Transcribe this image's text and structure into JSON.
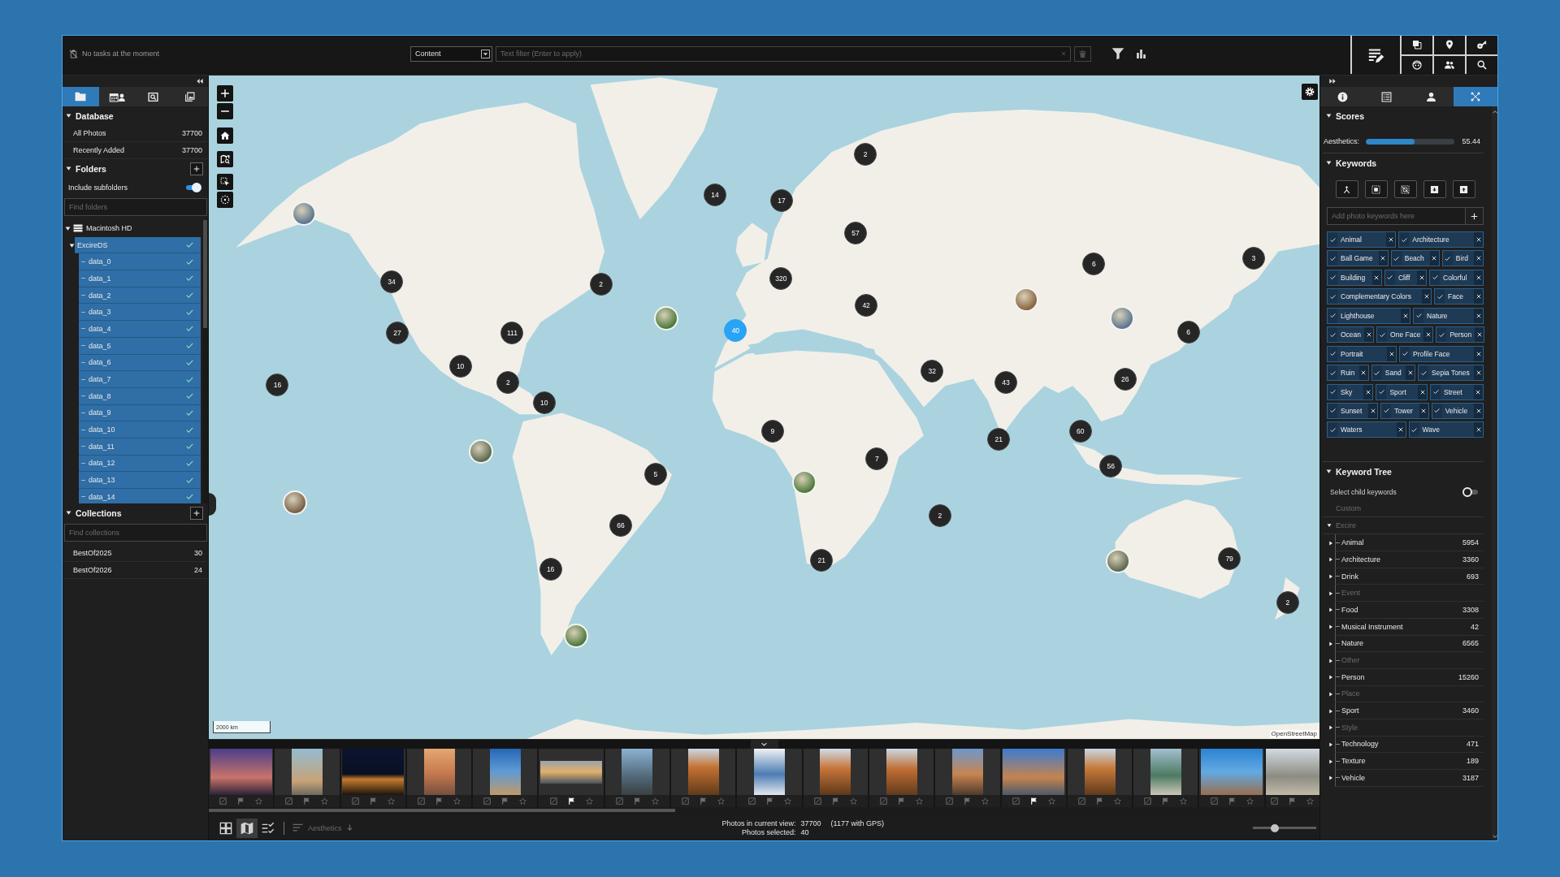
{
  "topbar": {
    "tasks": "No tasks at the moment",
    "content_select": {
      "value": "Content"
    },
    "text_filter": {
      "placeholder": "Text filter (Enter to apply)"
    }
  },
  "left_sidebar": {
    "tabs": [
      {
        "kind": "folders",
        "selected": true
      },
      {
        "kind": "calendar-people",
        "selected": false
      },
      {
        "kind": "image-search",
        "selected": false
      },
      {
        "kind": "gallery",
        "selected": false
      }
    ],
    "database": {
      "title": "Database",
      "expanded": true,
      "items": [
        {
          "label": "All Photos",
          "count": "37700"
        },
        {
          "label": "Recently Added",
          "count": "37700"
        }
      ]
    },
    "folders": {
      "title": "Folders",
      "expanded": true,
      "include_subfolders": {
        "label": "Include subfolders",
        "on": true
      },
      "search": {
        "placeholder": "Find folders"
      },
      "tree": [
        {
          "label": "Macintosh HD",
          "expanded": true,
          "selected": false,
          "children": [
            {
              "label": "ExcireDS",
              "expanded": true,
              "selected": true,
              "checked": true,
              "children": [
                {
                  "label": "data_0",
                  "selected": true,
                  "checked": true
                },
                {
                  "label": "data_1",
                  "selected": true,
                  "checked": true
                },
                {
                  "label": "data_2",
                  "selected": true,
                  "checked": true
                },
                {
                  "label": "data_3",
                  "selected": true,
                  "checked": true
                },
                {
                  "label": "data_4",
                  "selected": true,
                  "checked": true
                },
                {
                  "label": "data_5",
                  "selected": true,
                  "checked": true
                },
                {
                  "label": "data_6",
                  "selected": true,
                  "checked": true
                },
                {
                  "label": "data_7",
                  "selected": true,
                  "checked": true
                },
                {
                  "label": "data_8",
                  "selected": true,
                  "checked": true
                },
                {
                  "label": "data_9",
                  "selected": true,
                  "checked": true
                },
                {
                  "label": "data_10",
                  "selected": true,
                  "checked": true
                },
                {
                  "label": "data_11",
                  "selected": true,
                  "checked": true
                },
                {
                  "label": "data_12",
                  "selected": true,
                  "checked": true
                },
                {
                  "label": "data_13",
                  "selected": true,
                  "checked": true
                },
                {
                  "label": "data_14",
                  "selected": true,
                  "checked": true
                }
              ]
            }
          ]
        }
      ]
    },
    "collections": {
      "title": "Collections",
      "expanded": true,
      "search": {
        "placeholder": "Find collections"
      },
      "items": [
        {
          "label": "BestOf2025",
          "count": "30"
        },
        {
          "label": "BestOf2026",
          "count": "24"
        }
      ]
    }
  },
  "map": {
    "markers": [
      {
        "kind": "cluster",
        "count": "2",
        "selected": false
      },
      {
        "kind": "cluster",
        "count": "14",
        "selected": false
      },
      {
        "kind": "cluster",
        "count": "17",
        "selected": false
      },
      {
        "kind": "photo",
        "selected": false
      },
      {
        "kind": "cluster",
        "count": "57",
        "selected": false
      },
      {
        "kind": "cluster",
        "count": "6",
        "selected": false
      },
      {
        "kind": "cluster",
        "count": "3",
        "selected": false
      },
      {
        "kind": "cluster",
        "count": "34",
        "selected": false
      },
      {
        "kind": "cluster",
        "count": "2",
        "selected": false
      },
      {
        "kind": "cluster",
        "count": "320",
        "selected": false
      },
      {
        "kind": "cluster",
        "count": "42",
        "selected": false
      },
      {
        "kind": "photo",
        "selected": false
      },
      {
        "kind": "photo",
        "selected": false
      },
      {
        "kind": "photo",
        "selected": false
      },
      {
        "kind": "cluster",
        "count": "27",
        "selected": false
      },
      {
        "kind": "cluster",
        "count": "111",
        "selected": false
      },
      {
        "kind": "cluster",
        "count": "40",
        "selected": true
      },
      {
        "kind": "cluster",
        "count": "6",
        "selected": false
      },
      {
        "kind": "cluster",
        "count": "10",
        "selected": false
      },
      {
        "kind": "cluster",
        "count": "32",
        "selected": false
      },
      {
        "kind": "cluster",
        "count": "16",
        "selected": false
      },
      {
        "kind": "cluster",
        "count": "2",
        "selected": false
      },
      {
        "kind": "cluster",
        "count": "43",
        "selected": false
      },
      {
        "kind": "cluster",
        "count": "26",
        "selected": false
      },
      {
        "kind": "cluster",
        "count": "10",
        "selected": false
      },
      {
        "kind": "cluster",
        "count": "9",
        "selected": false
      },
      {
        "kind": "cluster",
        "count": "21",
        "selected": false
      },
      {
        "kind": "cluster",
        "count": "60",
        "selected": false
      },
      {
        "kind": "photo",
        "selected": false
      },
      {
        "kind": "cluster",
        "count": "7",
        "selected": false
      },
      {
        "kind": "cluster",
        "count": "5",
        "selected": false
      },
      {
        "kind": "cluster",
        "count": "56",
        "selected": false
      },
      {
        "kind": "photo",
        "selected": false
      },
      {
        "kind": "edge-cluster",
        "selected": false
      },
      {
        "kind": "photo",
        "selected": false
      },
      {
        "kind": "cluster",
        "count": "66",
        "selected": false
      },
      {
        "kind": "cluster",
        "count": "2",
        "selected": false
      },
      {
        "kind": "cluster",
        "count": "21",
        "selected": false
      },
      {
        "kind": "photo",
        "selected": false
      },
      {
        "kind": "cluster",
        "count": "79",
        "selected": false
      },
      {
        "kind": "cluster",
        "count": "16",
        "selected": false
      },
      {
        "kind": "cluster",
        "count": "2",
        "selected": false
      },
      {
        "kind": "photo",
        "selected": false
      }
    ],
    "scale": "2000 km",
    "attribution": "OpenStreetMap"
  },
  "filmstrip": {
    "thumbnails": [
      {
        "flagged": false
      },
      {
        "flagged": false
      },
      {
        "flagged": false
      },
      {
        "flagged": false
      },
      {
        "flagged": false
      },
      {
        "flagged": true
      },
      {
        "flagged": false
      },
      {
        "flagged": false
      },
      {
        "flagged": false
      },
      {
        "flagged": false
      },
      {
        "flagged": false
      },
      {
        "flagged": false
      },
      {
        "flagged": true
      },
      {
        "flagged": false
      },
      {
        "flagged": false
      },
      {
        "flagged": false
      },
      {
        "flagged": false
      }
    ]
  },
  "status_bar": {
    "view_modes": [
      {
        "kind": "grid",
        "selected": false
      },
      {
        "kind": "map",
        "selected": true
      },
      {
        "kind": "checklist",
        "selected": false
      }
    ],
    "sort": {
      "label": "Aesthetics",
      "disabled": true
    },
    "lines": [
      {
        "label": "Photos in current view:",
        "value": "37700",
        "note": "(1177 with GPS)"
      },
      {
        "label": "Photos selected:",
        "value": "40"
      }
    ],
    "zoom_slider": {
      "level": 0.33
    }
  },
  "right_panel": {
    "tabs": [
      {
        "kind": "info",
        "selected": false
      },
      {
        "kind": "details",
        "selected": false
      },
      {
        "kind": "person",
        "selected": false
      },
      {
        "kind": "network",
        "selected": true
      }
    ],
    "scores": {
      "title": "Scores",
      "expanded": true,
      "items": [
        {
          "label": "Aesthetics:",
          "level": 0.55,
          "reading": "55.44"
        }
      ]
    },
    "keywords": {
      "title": "Keywords",
      "expanded": true,
      "input": {
        "placeholder": "Add photo keywords here"
      },
      "chips": [
        {
          "label": "Animal",
          "checked": true
        },
        {
          "label": "Architecture",
          "checked": true
        },
        {
          "label": "Ball Game",
          "checked": true
        },
        {
          "label": "Beach",
          "checked": true
        },
        {
          "label": "Bird",
          "checked": true
        },
        {
          "label": "Building",
          "checked": true
        },
        {
          "label": "Cliff",
          "checked": true
        },
        {
          "label": "Colorful",
          "checked": true
        },
        {
          "label": "Complementary Colors",
          "checked": true
        },
        {
          "label": "Face",
          "checked": true
        },
        {
          "label": "Lighthouse",
          "checked": true
        },
        {
          "label": "Nature",
          "checked": true
        },
        {
          "label": "Ocean",
          "checked": true
        },
        {
          "label": "One Face",
          "checked": true
        },
        {
          "label": "Person",
          "checked": true
        },
        {
          "label": "Portrait",
          "checked": true
        },
        {
          "label": "Profile Face",
          "checked": true
        },
        {
          "label": "Ruin",
          "checked": true
        },
        {
          "label": "Sand",
          "checked": true
        },
        {
          "label": "Sepia Tones",
          "checked": true
        },
        {
          "label": "Sky",
          "checked": true
        },
        {
          "label": "Sport",
          "checked": true
        },
        {
          "label": "Street",
          "checked": true
        },
        {
          "label": "Sunset",
          "checked": true
        },
        {
          "label": "Tower",
          "checked": true
        },
        {
          "label": "Vehicle",
          "checked": true
        },
        {
          "label": "Waters",
          "checked": true
        },
        {
          "label": "Wave",
          "checked": true
        }
      ]
    },
    "keyword_tree": {
      "title": "Keyword Tree",
      "expanded": true,
      "select_child": {
        "label": "Select child keywords",
        "on": false
      },
      "items": [
        {
          "label": "Custom",
          "disabled": true
        },
        {
          "label": "Excire",
          "disabled": true,
          "expanded": true,
          "children": [
            {
              "label": "Animal",
              "count": "5954",
              "expanded": false,
              "disabled": false
            },
            {
              "label": "Architecture",
              "count": "3360",
              "expanded": false,
              "disabled": false
            },
            {
              "label": "Drink",
              "count": "693",
              "expanded": false,
              "disabled": false
            },
            {
              "label": "Event",
              "expanded": false,
              "disabled": true
            },
            {
              "label": "Food",
              "count": "3308",
              "expanded": false,
              "disabled": false
            },
            {
              "label": "Musical Instrument",
              "count": "42",
              "expanded": false,
              "disabled": false
            },
            {
              "label": "Nature",
              "count": "6565",
              "expanded": false,
              "disabled": false
            },
            {
              "label": "Other",
              "expanded": false,
              "disabled": true
            },
            {
              "label": "Person",
              "count": "15260",
              "expanded": false,
              "disabled": false
            },
            {
              "label": "Place",
              "expanded": false,
              "disabled": true
            },
            {
              "label": "Sport",
              "count": "3460",
              "expanded": false,
              "disabled": false
            },
            {
              "label": "Style",
              "expanded": false,
              "disabled": true
            },
            {
              "label": "Technology",
              "count": "471",
              "expanded": false,
              "disabled": false
            },
            {
              "label": "Texture",
              "count": "189",
              "expanded": false,
              "disabled": false
            },
            {
              "label": "Vehicle",
              "count": "3187",
              "expanded": false,
              "disabled": false
            }
          ]
        }
      ]
    }
  }
}
